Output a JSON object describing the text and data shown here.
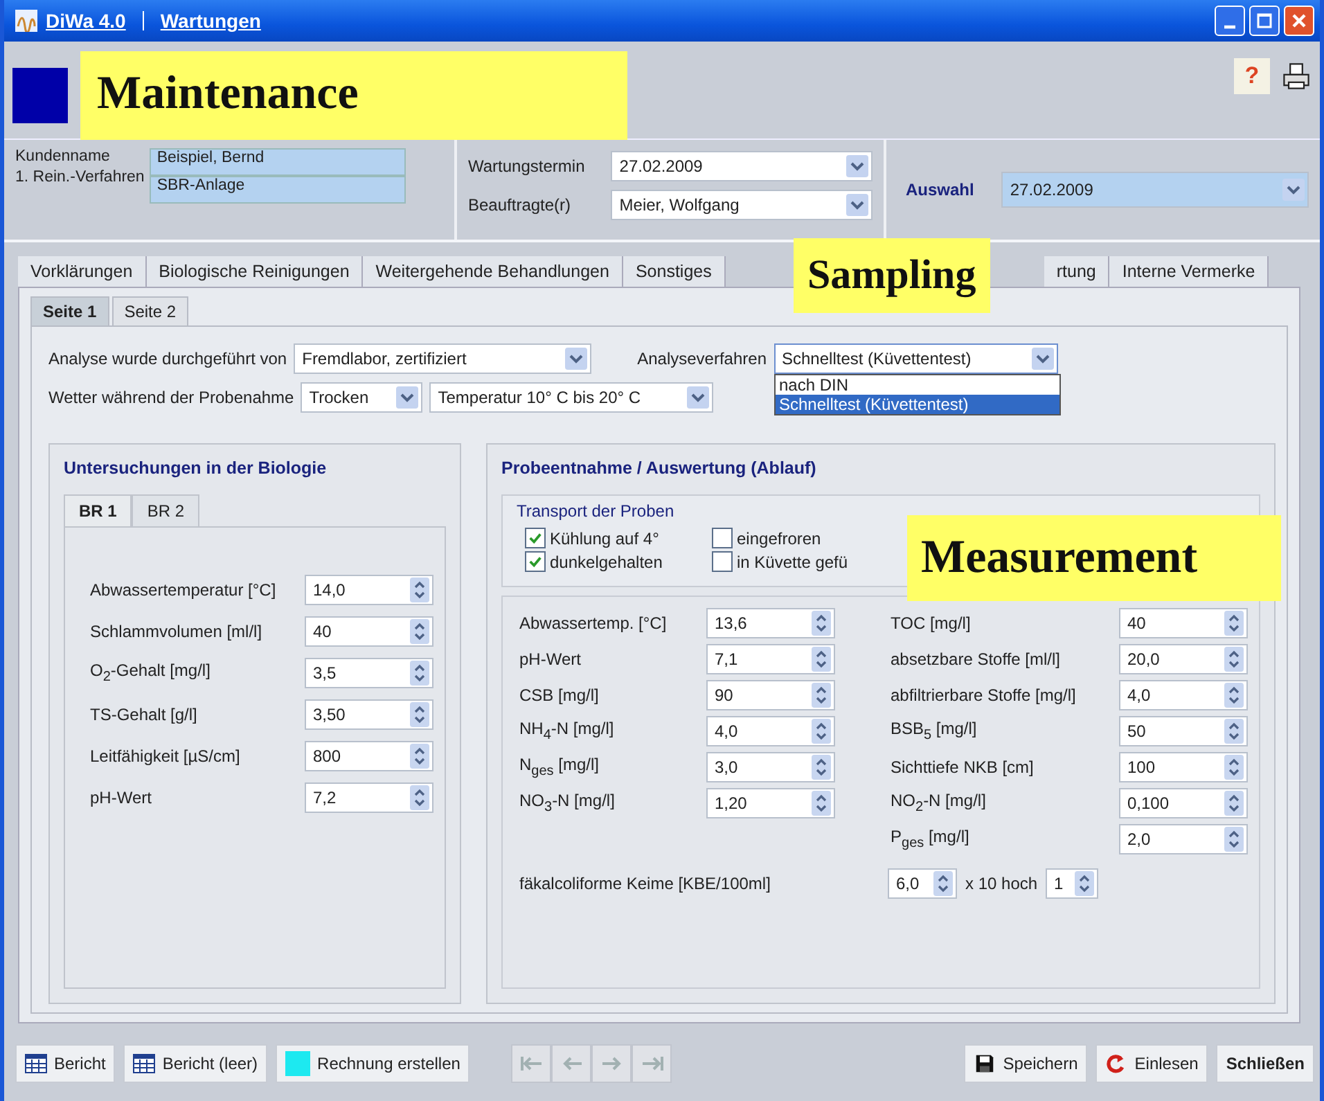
{
  "window": {
    "title": "DiWa 4.0",
    "module": "Wartungen"
  },
  "callouts": [
    {
      "text": "Maintenance"
    },
    {
      "text": "Sampling"
    },
    {
      "text": "Measurement"
    }
  ],
  "toolbar": {
    "help": "?"
  },
  "header": {
    "customer": [
      {
        "label": "Kundenname",
        "value": "Beispiel, Bernd"
      },
      {
        "label": "1. Rein.-Verfahren",
        "value": "SBR-Anlage"
      }
    ],
    "appointment": [
      {
        "label": "Wartungstermin",
        "value": "27.02.2009"
      },
      {
        "label": "Beauftragte(r)",
        "value": "Meier, Wolfgang"
      }
    ],
    "selection": {
      "label": "Auswahl",
      "value": "27.02.2009"
    }
  },
  "main_tabs": [
    {
      "label": "Vorklärungen",
      "selected": false
    },
    {
      "label": "Biologische Reinigungen",
      "selected": false
    },
    {
      "label": "Weitergehende Behandlungen",
      "selected": false
    },
    {
      "label": "Sonstiges",
      "selected": false
    },
    {
      "label": "rtung",
      "selected": false
    },
    {
      "label": "Interne Vermerke",
      "selected": false
    }
  ],
  "sub_tabs": [
    {
      "label": "Seite 1",
      "selected": true
    },
    {
      "label": "Seite 2",
      "selected": false
    }
  ],
  "analysis": {
    "performed_by": {
      "label": "Analyse wurde durchgeführt von",
      "value": "Fremdlabor, zertifiziert"
    },
    "method": {
      "label": "Analyseverfahren",
      "value": "Schnelltest (Küvettentest)",
      "expanded": true,
      "options": [
        {
          "label": "nach DIN",
          "selected": false
        },
        {
          "label": "Schnelltest (Küvettentest)",
          "selected": true
        }
      ]
    },
    "weather": {
      "label": "Wetter während der Probenahme",
      "condition": "Trocken",
      "temperature": "Temperatur 10° C bis 20° C"
    }
  },
  "biology": {
    "title": "Untersuchungen in der Biologie",
    "tabs": [
      {
        "label": "BR 1",
        "selected": true
      },
      {
        "label": "BR 2",
        "selected": false
      }
    ],
    "fields": [
      {
        "label": "Abwassertemperatur [°C]",
        "value": "14,0"
      },
      {
        "label": "Schlammvolumen [ml/l]",
        "value": "40"
      },
      {
        "label": "O$_{2}$-Gehalt [mg/l]",
        "value": "3,5"
      },
      {
        "label": "TS-Gehalt [g/l]",
        "value": "3,50"
      },
      {
        "label": "Leitfähigkeit [µS/cm]",
        "value": "800"
      },
      {
        "label": "pH-Wert",
        "value": "7,2"
      }
    ]
  },
  "sampling": {
    "title": "Probeentnahme / Auswertung (Ablauf)",
    "transport": {
      "title": "Transport der Proben",
      "options": [
        {
          "label": "Kühlung auf 4°",
          "checked": true
        },
        {
          "label": "eingefroren",
          "checked": false
        },
        {
          "label": "dunkelgehalten",
          "checked": true
        },
        {
          "label": "in Küvette gefü",
          "checked": false
        }
      ]
    },
    "left_fields": [
      {
        "label": "Abwassertemp. [°C]",
        "value": "13,6"
      },
      {
        "label": "pH-Wert",
        "value": "7,1"
      },
      {
        "label": "CSB [mg/l]",
        "value": "90"
      },
      {
        "label": "NH$_{4}$-N [mg/l]",
        "value": "4,0"
      },
      {
        "label": "N$_{ges}$ [mg/l]",
        "value": "3,0"
      },
      {
        "label": "NO$_{3}$-N [mg/l]",
        "value": "1,20"
      }
    ],
    "right_fields": [
      {
        "label": "TOC [mg/l]",
        "value": "40"
      },
      {
        "label": "absetzbare Stoffe [ml/l]",
        "value": "20,0"
      },
      {
        "label": "abfiltrierbare Stoffe [mg/l]",
        "value": "4,0"
      },
      {
        "label": "BSB$_{5}$ [mg/l]",
        "value": "50"
      },
      {
        "label": "Sichttiefe NKB [cm]",
        "value": "100"
      },
      {
        "label": "NO$_{2}$-N [mg/l]",
        "value": "0,100"
      },
      {
        "label": "P$_{ges}$ [mg/l]",
        "value": "2,0"
      }
    ],
    "coliform": {
      "label": "fäkalcoliforme Keime [KBE/100ml]",
      "value": "6,0",
      "multiplier": "x 10 hoch",
      "exponent": "1"
    }
  },
  "footer": {
    "left_buttons": [
      {
        "label": "Bericht",
        "kind": "report"
      },
      {
        "label": "Bericht (leer)",
        "kind": "report"
      },
      {
        "label": "Rechnung erstellen",
        "kind": "invoice"
      }
    ],
    "navigation_disabled": true,
    "right_buttons": [
      {
        "label": "Speichern",
        "kind": "save"
      },
      {
        "label": "Einlesen",
        "kind": "import"
      },
      {
        "label": "Schließen",
        "kind": "close"
      }
    ]
  }
}
